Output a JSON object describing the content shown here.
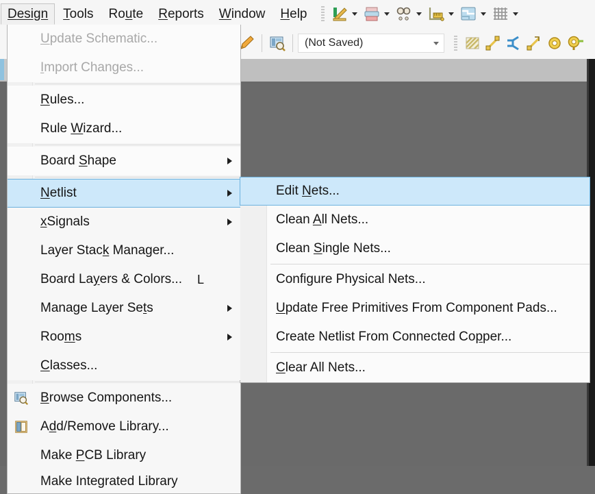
{
  "menubar": {
    "items": [
      {
        "label": "Design",
        "mnemonic": "D",
        "active": true
      },
      {
        "label": "Tools",
        "mnemonic": "T",
        "active": false
      },
      {
        "label": "Route",
        "mnemonic": "u",
        "active": false
      },
      {
        "label": "Reports",
        "mnemonic": "R",
        "active": false
      },
      {
        "label": "Window",
        "mnemonic": "W",
        "active": false
      },
      {
        "label": "Help",
        "mnemonic": "H",
        "active": false
      }
    ],
    "toolbar_icons": [
      {
        "name": "design-rule-check-icon",
        "caret": true
      },
      {
        "name": "printer-icon",
        "caret": true
      },
      {
        "name": "find-similar-objects-icon",
        "caret": true
      },
      {
        "name": "measure-ruler-icon",
        "caret": true
      },
      {
        "name": "layer-stack-icon",
        "caret": true
      },
      {
        "name": "grid-icon",
        "caret": true
      }
    ]
  },
  "toolbar2": {
    "pencil_icon": "edit-pencil-icon",
    "browse_icon": "browse-components-icon",
    "combo_value": "(Not Saved)",
    "combo_placeholder": "(Not Saved)",
    "right_icons": [
      {
        "name": "polygon-pour-icon"
      },
      {
        "name": "interactive-routing-icon"
      },
      {
        "name": "differential-pair-routing-icon"
      },
      {
        "name": "interactive-length-tuning-icon"
      },
      {
        "name": "place-via-icon"
      },
      {
        "name": "place-pad-icon"
      }
    ]
  },
  "design_menu": {
    "items": [
      {
        "label": "Update Schematic...",
        "mnemonic": "U",
        "disabled": true,
        "arrow": false,
        "accel": "",
        "icon": "",
        "sep_after": false
      },
      {
        "label": "Import Changes...",
        "mnemonic": "I",
        "disabled": true,
        "arrow": false,
        "accel": "",
        "icon": "",
        "sep_after": true
      },
      {
        "label": "Rules...",
        "mnemonic": "R",
        "disabled": false,
        "arrow": false,
        "accel": "",
        "icon": "",
        "sep_after": false
      },
      {
        "label": "Rule Wizard...",
        "mnemonic": "W",
        "disabled": false,
        "arrow": false,
        "accel": "",
        "icon": "",
        "sep_after": true
      },
      {
        "label": "Board Shape",
        "mnemonic": "S",
        "disabled": false,
        "arrow": true,
        "accel": "",
        "icon": "",
        "sep_after": true
      },
      {
        "label": "Netlist",
        "mnemonic": "N",
        "disabled": false,
        "arrow": true,
        "accel": "",
        "icon": "",
        "selected": true,
        "sep_after": false
      },
      {
        "label": "xSignals",
        "mnemonic": "x",
        "disabled": false,
        "arrow": true,
        "accel": "",
        "icon": "",
        "sep_after": false
      },
      {
        "label": "Layer Stack Manager...",
        "mnemonic": "k",
        "disabled": false,
        "arrow": false,
        "accel": "",
        "icon": "",
        "sep_after": false
      },
      {
        "label": "Board Layers & Colors...",
        "mnemonic": "y",
        "disabled": false,
        "arrow": false,
        "accel": "L",
        "icon": "",
        "sep_after": false
      },
      {
        "label": "Manage Layer Sets",
        "mnemonic": "t",
        "disabled": false,
        "arrow": true,
        "accel": "",
        "icon": "",
        "sep_after": false
      },
      {
        "label": "Rooms",
        "mnemonic": "m",
        "disabled": false,
        "arrow": true,
        "accel": "",
        "icon": "",
        "sep_after": false
      },
      {
        "label": "Classes...",
        "mnemonic": "C",
        "disabled": false,
        "arrow": false,
        "accel": "",
        "icon": "",
        "sep_after": true
      },
      {
        "label": "Browse Components...",
        "mnemonic": "B",
        "disabled": false,
        "arrow": false,
        "accel": "",
        "icon": "browse-components-icon",
        "sep_after": false
      },
      {
        "label": "Add/Remove Library...",
        "mnemonic": "d",
        "disabled": false,
        "arrow": false,
        "accel": "",
        "icon": "library-icon",
        "sep_after": false
      },
      {
        "label": "Make PCB Library",
        "mnemonic": "P",
        "disabled": false,
        "arrow": false,
        "accel": "",
        "icon": "",
        "sep_after": false
      },
      {
        "label": "Make Integrated Library",
        "mnemonic": "",
        "disabled": false,
        "arrow": false,
        "accel": "",
        "icon": "",
        "sep_after": false
      }
    ]
  },
  "netlist_submenu": {
    "items": [
      {
        "label": "Edit Nets...",
        "mnemonic": "N",
        "selected": true,
        "sep_after": false
      },
      {
        "label": "Clean All Nets...",
        "mnemonic": "A",
        "selected": false,
        "sep_after": false
      },
      {
        "label": "Clean Single Nets...",
        "mnemonic": "S",
        "selected": false,
        "sep_after": true
      },
      {
        "label": "Configure Physical Nets...",
        "mnemonic": "g",
        "selected": false,
        "sep_after": false
      },
      {
        "label": "Update Free Primitives From Component Pads...",
        "mnemonic": "U",
        "selected": false,
        "sep_after": false
      },
      {
        "label": "Create Netlist From Connected Copper...",
        "mnemonic": "p",
        "selected": false,
        "sep_after": true
      },
      {
        "label": "Clear All Nets...",
        "mnemonic": "C",
        "selected": false,
        "sep_after": false
      }
    ]
  },
  "annotation": {
    "arrow_name": "red-pointer-arrow",
    "arrow_color": "#e03127",
    "points_to": "Edit Nets..."
  },
  "colors": {
    "selection_fill": "#cde8fa",
    "selection_border": "#6ab0dd",
    "canvas_dark": "#6a6a6a",
    "menu_bg": "#f7f7f7"
  }
}
